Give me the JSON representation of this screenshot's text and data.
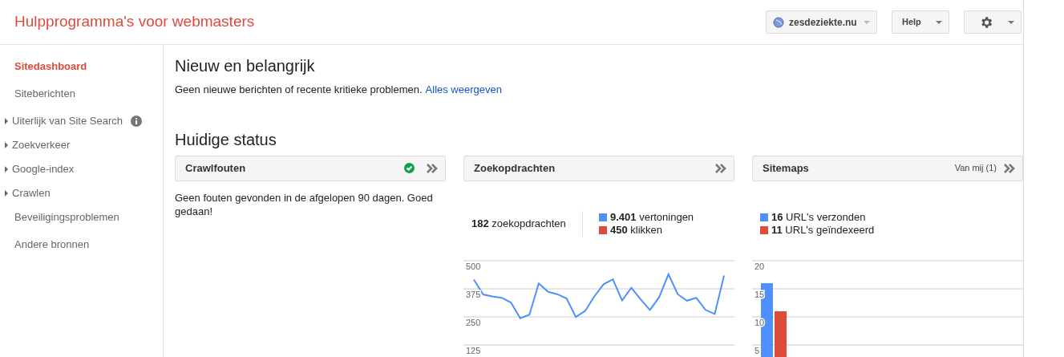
{
  "header": {
    "title": "Hulpprogramma's voor webmasters",
    "site_selector": "zesdeziekte.nu",
    "help_button": "Help"
  },
  "sidebar": {
    "items": [
      {
        "label": "Sitedashboard",
        "kind": "link",
        "selected": true
      },
      {
        "label": "Siteberichten",
        "kind": "link",
        "selected": false
      },
      {
        "label": "Uiterlijk van Site Search",
        "kind": "expandable",
        "info": true,
        "selected": false
      },
      {
        "label": "Zoekverkeer",
        "kind": "expandable",
        "selected": false
      },
      {
        "label": "Google-index",
        "kind": "expandable",
        "selected": false
      },
      {
        "label": "Crawlen",
        "kind": "expandable",
        "selected": false
      },
      {
        "label": "Beveiligingsproblemen",
        "kind": "link",
        "selected": false
      },
      {
        "label": "Andere bronnen",
        "kind": "link",
        "selected": false
      }
    ]
  },
  "news": {
    "heading": "Nieuw en belangrijk",
    "message": "Geen nieuwe berichten of recente kritieke problemen.",
    "link": "Alles weergeven"
  },
  "status": {
    "heading": "Huidige status",
    "cards": [
      {
        "kind": "text",
        "title": "Crawlfouten",
        "ok": true,
        "body": "Geen fouten gevonden in de afgelopen 90 dagen. Goed gedaan!"
      },
      {
        "kind": "line",
        "title": "Zoekopdrachten",
        "summary": "**182** zoekopdrachten",
        "legend": [
          {
            "text": "**9.401** vertoningen",
            "color": "#4d90fe"
          },
          {
            "text": "**450** klikken",
            "color": "#dd4b39"
          }
        ],
        "chart_data": {
          "type": "line",
          "yticks": [
            125,
            250,
            375,
            500
          ],
          "ylim": [
            125,
            500
          ],
          "grid": true,
          "series": [
            {
              "color": "#4d90fe",
              "values": [
                416,
                350,
                341,
                335,
                314,
                244,
                260,
                399,
                362,
                351,
                332,
                250,
                276,
                341,
                395,
                417,
                323,
                380,
                328,
                281,
                338,
                440,
                351,
                322,
                335,
                281,
                263,
                434
              ]
            }
          ]
        }
      },
      {
        "kind": "bar",
        "title": "Sitemaps",
        "filter": "Van mij (1)",
        "legend": [
          {
            "text": "**16** URL's verzonden",
            "color": "#4d90fe"
          },
          {
            "text": "**11** URL's geïndexeerd",
            "color": "#dd4b39"
          }
        ],
        "chart_data": {
          "type": "bar",
          "yticks": [
            5,
            10,
            15,
            20
          ],
          "ylim": [
            5,
            20
          ],
          "grid": true,
          "series": [
            {
              "color": "#4d90fe",
              "values": [
                16
              ]
            },
            {
              "color": "#dd4b39",
              "values": [
                11
              ]
            }
          ]
        }
      }
    ]
  }
}
